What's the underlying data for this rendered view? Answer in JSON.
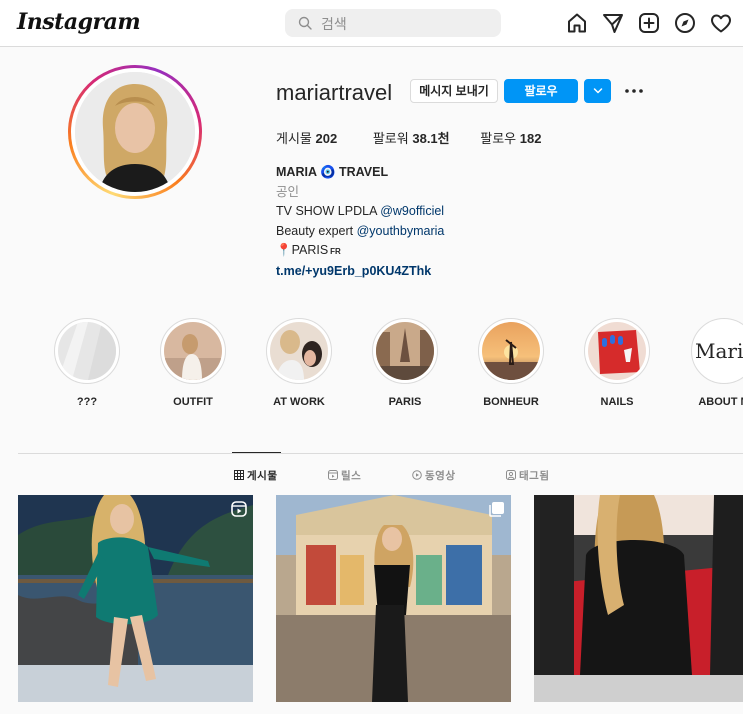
{
  "app": {
    "logo": "Instagram"
  },
  "search": {
    "placeholder": "검색",
    "value": ""
  },
  "nav": {
    "icons": [
      "home-icon",
      "direct-message-icon",
      "new-post-icon",
      "explore-icon",
      "activity-heart-icon"
    ]
  },
  "profile": {
    "username": "mariartravel",
    "message_label": "메시지 보내기",
    "follow_label": "팔로우",
    "stats": {
      "posts_label": "게시물",
      "posts_count": "202",
      "followers_label": "팔로워",
      "followers_count": "38.1천",
      "following_label": "팔로우",
      "following_count": "182"
    },
    "bio": {
      "name": "MARIA 🧿 TRAVEL",
      "category": "공인",
      "line1_text": "TV SHOW LPDLA ",
      "line1_handle": "@w9officiel",
      "line2_text": "Beauty expert ",
      "line2_handle": "@youthbymaria",
      "line3_pin": "📍",
      "line3_text": "PARIS",
      "line3_small": "FR",
      "link": "t.me/+yu9Erb_p0KU4ZThk"
    }
  },
  "highlights": [
    {
      "label": "???"
    },
    {
      "label": "OUTFIT"
    },
    {
      "label": "AT WORK"
    },
    {
      "label": "PARIS"
    },
    {
      "label": "BONHEUR"
    },
    {
      "label": "NAILS"
    },
    {
      "label": "ABOUT M",
      "cover_text": "Maria"
    }
  ],
  "tabs": [
    {
      "label": "게시물",
      "active": true
    },
    {
      "label": "릴스",
      "active": false
    },
    {
      "label": "동영상",
      "active": false
    },
    {
      "label": "태그됨",
      "active": false
    }
  ],
  "colors": {
    "accent": "#0095f6",
    "link": "#00376b",
    "muted": "#8e8e8e",
    "border": "#dbdbdb"
  }
}
